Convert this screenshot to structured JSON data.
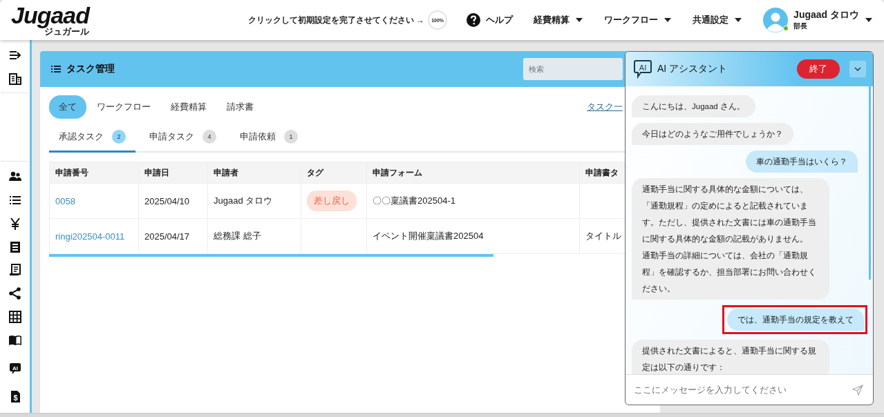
{
  "header": {
    "logo": "Jugaad",
    "logo_sub": "ジュガール",
    "setup_prompt": "クリックして初期設定を完了させてください →",
    "setup_progress": "100%",
    "help": "ヘルプ",
    "menus": [
      "経費精算",
      "ワークフロー",
      "共通設定"
    ],
    "user": {
      "name": "Jugaad タロウ",
      "role": "部長",
      "online": true
    }
  },
  "sidebar": {
    "ai_label": "AI",
    "dollar_label": "$"
  },
  "task_panel": {
    "title": "タスク管理",
    "search": {
      "placeholder": "検索"
    },
    "category_tabs": [
      {
        "label": "全て",
        "selected": true
      },
      {
        "label": "ワークフロー",
        "selected": false
      },
      {
        "label": "経費精算",
        "selected": false
      },
      {
        "label": "請求書",
        "selected": false
      }
    ],
    "task_list_link": "タスク一",
    "task_tabs": [
      {
        "label": "承認タスク",
        "count": "2",
        "selected": true
      },
      {
        "label": "申請タスク",
        "count": "4",
        "selected": false
      },
      {
        "label": "申請依頼",
        "count": "1",
        "selected": false
      }
    ],
    "table": {
      "columns": [
        "申請番号",
        "申請日",
        "申請者",
        "タグ",
        "申請フォーム",
        "申請書タ"
      ],
      "rows": [
        {
          "number": "0058",
          "date": "2025/04/10",
          "applicant": "Jugaad タロウ",
          "tag": "差し戻し",
          "form": "〇〇稟議書202504-1",
          "column_6": ""
        },
        {
          "number": "ringi202504-0011",
          "date": "2025/04/17",
          "applicant": "総務課 総子",
          "tag": "",
          "form": "イベント開催稟議書202504",
          "column_6": "タイトル"
        }
      ]
    }
  },
  "assistant": {
    "icon_label": "AI",
    "title": "AI アシスタント",
    "end_button": "終了",
    "messages": [
      {
        "kind": "bot",
        "text": "こんにちは、Jugaad さん。",
        "highlighted": false
      },
      {
        "kind": "bot",
        "text": "今日はどのようなご用件でしょうか？",
        "highlighted": false
      },
      {
        "kind": "user",
        "text": "車の通勤手当はいくら？",
        "highlighted": false
      },
      {
        "kind": "bot",
        "text": "通勤手当に関する具体的な金額については、「通勤規程」の定めによると記載されています。ただし、提供された文書には車の通勤手当に関する具体的な金額の記載がありません。",
        "text_2": "通勤手当の詳細については、会社の「通勤規程」を確認するか、担当部署にお問い合わせください。",
        "highlighted": false
      },
      {
        "kind": "user",
        "text": "では、通勤手当の規定を教えて",
        "highlighted": true
      },
      {
        "kind": "bot",
        "text": "提供された文書によると、通勤手当に関する規定は以下の通りです：",
        "highlighted": false
      }
    ],
    "input": {
      "placeholder": "ここにメッセージを入力してください"
    }
  }
}
